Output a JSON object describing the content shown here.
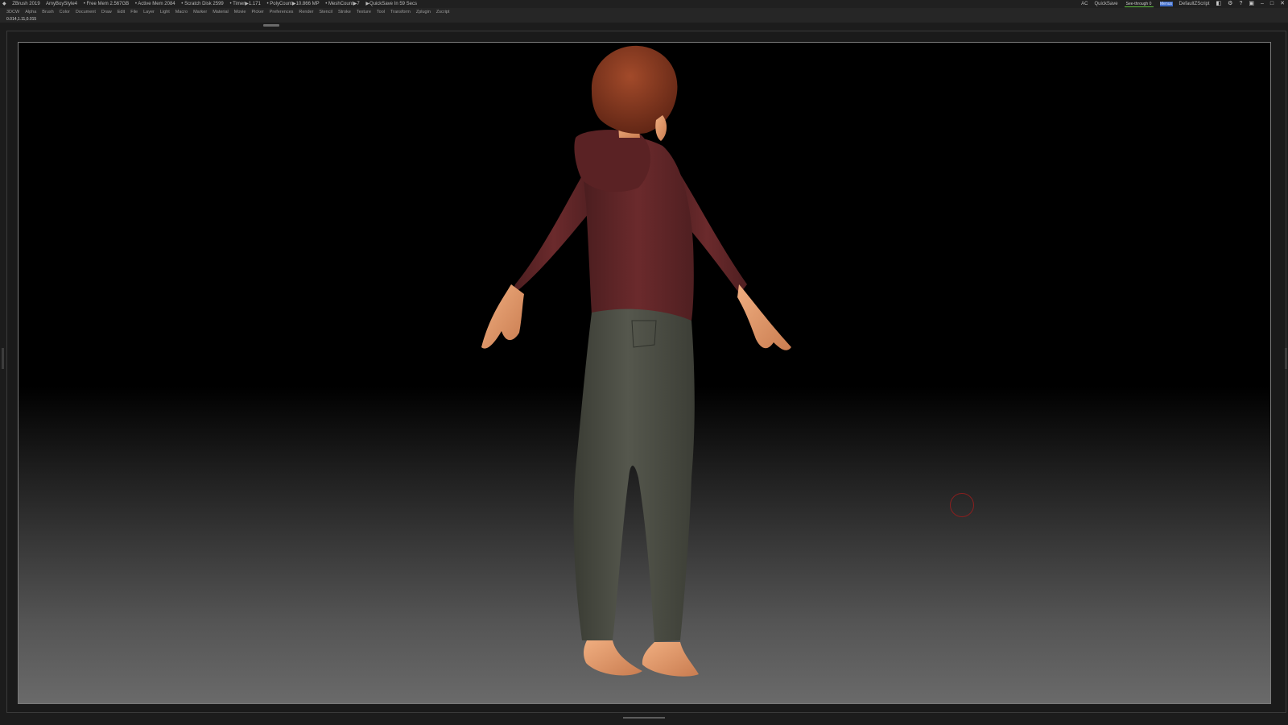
{
  "title_bar": {
    "app": "ZBrush 2019",
    "document": "AmyBoyStyle4",
    "free_mem": "• Free Mem 2.567GB",
    "active_mem": "• Active Mem 2084",
    "scratch_disk": "• Scratch Disk 2599",
    "timer": "• Timer▶1.171",
    "polycount": "• PolyCount▶10.866 MP",
    "meshcount": "• MeshCount▶7",
    "quicksave": "▶QuickSave In 59 Secs",
    "ac_label": "AC",
    "quicksave_button": "QuickSave",
    "see_through": "See-through  0",
    "menus_button": "Menus",
    "default_zscript": "DefaultZScript"
  },
  "menu_bar": {
    "items": [
      "3DCW",
      "Alpha",
      "Brush",
      "Color",
      "Document",
      "Draw",
      "Edit",
      "File",
      "Layer",
      "Light",
      "Macro",
      "Marker",
      "Material",
      "Movie",
      "Picker",
      "Preferences",
      "Render",
      "Stencil",
      "Stroke",
      "Texture",
      "Tool",
      "Transform",
      "Zplugin",
      "Zscript"
    ]
  },
  "coord_bar": {
    "coordinates": "0.014,1.11,0.015"
  },
  "colors": {
    "hoodie": "#6b2a2c",
    "pants": "#4d4f45",
    "skin": "#e39b6a",
    "hair": "#8a3c22",
    "cursor": "#8a1f1f"
  }
}
